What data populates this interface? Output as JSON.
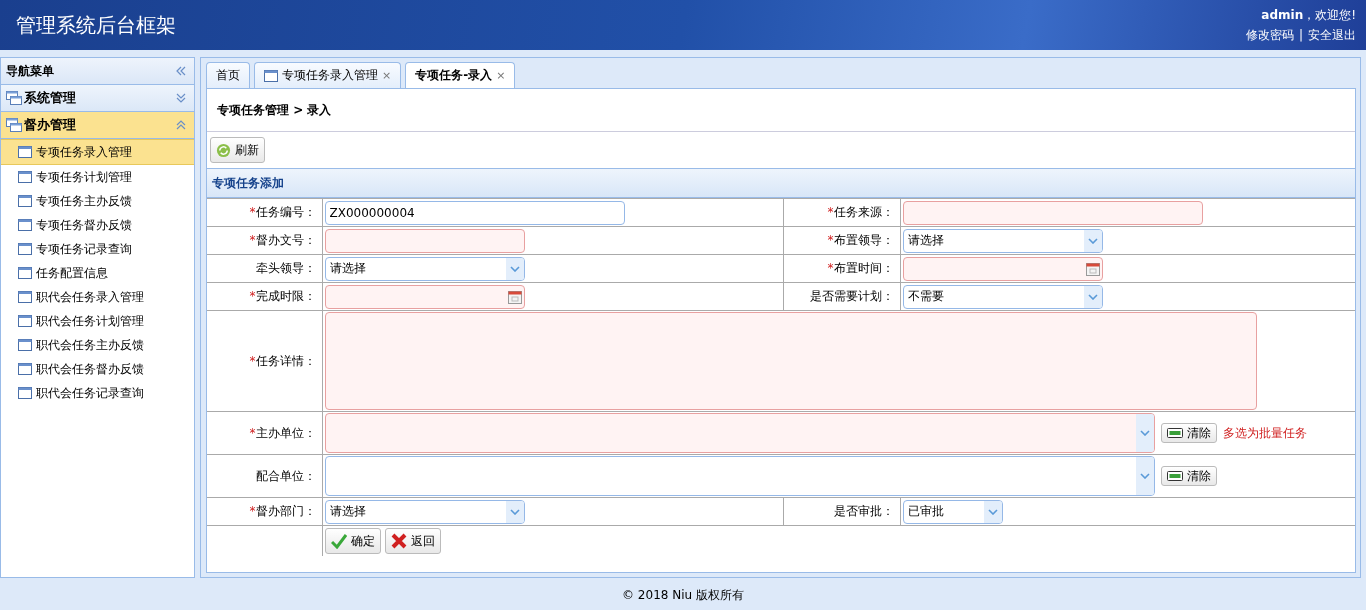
{
  "header": {
    "title": "管理系统后台框架",
    "user": "admin",
    "welcome": "，欢迎您!",
    "links": [
      "修改密码",
      "安全退出"
    ],
    "separator": "|"
  },
  "sidebar": {
    "title": "导航菜单",
    "groups": [
      {
        "label": "系统管理",
        "expanded": false,
        "selected": false
      },
      {
        "label": "督办管理",
        "expanded": true,
        "selected": true,
        "items": [
          {
            "label": "专项任务录入管理",
            "selected": true
          },
          {
            "label": "专项任务计划管理",
            "selected": false
          },
          {
            "label": "专项任务主办反馈",
            "selected": false
          },
          {
            "label": "专项任务督办反馈",
            "selected": false
          },
          {
            "label": "专项任务记录查询",
            "selected": false
          },
          {
            "label": "任务配置信息",
            "selected": false
          },
          {
            "label": "职代会任务录入管理",
            "selected": false
          },
          {
            "label": "职代会任务计划管理",
            "selected": false
          },
          {
            "label": "职代会任务主办反馈",
            "selected": false
          },
          {
            "label": "职代会任务督办反馈",
            "selected": false
          },
          {
            "label": "职代会任务记录查询",
            "selected": false
          }
        ]
      }
    ]
  },
  "tabs": [
    {
      "label": "首页",
      "selected": false,
      "icon": false
    },
    {
      "label": "专项任务录入管理",
      "selected": false,
      "icon": true,
      "close": "×"
    },
    {
      "label": "专项任务-录入",
      "selected": true,
      "icon": false,
      "close": "×"
    }
  ],
  "breadcrumb": "专项任务管理 > 录入",
  "toolbar": {
    "refresh": "刷新"
  },
  "form": {
    "title": "专项任务添加",
    "rows": [
      {
        "kind": "pair",
        "fields": [
          {
            "label": "任务编号：",
            "required": true,
            "kind": "text",
            "value": "ZX000000004",
            "invalid": false
          },
          {
            "label": "任务来源：",
            "required": true,
            "kind": "text",
            "invalid": true
          }
        ]
      },
      {
        "kind": "pair",
        "fields": [
          {
            "label": "督办文号：",
            "required": true,
            "kind": "text",
            "invalid": true
          },
          {
            "label": "布置领导：",
            "required": true,
            "kind": "select",
            "value": "请选择",
            "invalid": false
          }
        ]
      },
      {
        "kind": "pair",
        "fields": [
          {
            "label": "牵头领导：",
            "required": false,
            "kind": "select",
            "value": "请选择",
            "invalid": false
          },
          {
            "label": "布置时间：",
            "required": true,
            "kind": "date",
            "invalid": true
          }
        ]
      },
      {
        "kind": "pair",
        "fields": [
          {
            "label": "完成时限：",
            "required": true,
            "kind": "date",
            "invalid": true
          },
          {
            "label": "是否需要计划：",
            "required": false,
            "kind": "select",
            "value": "不需要",
            "invalid": false
          }
        ]
      },
      {
        "kind": "full",
        "fields": [
          {
            "label": "任务详情：",
            "required": true,
            "kind": "textarea",
            "invalid": true
          }
        ]
      },
      {
        "kind": "full",
        "fields": [
          {
            "label": "主办单位：",
            "required": true,
            "kind": "multi",
            "invalid": true,
            "clear": "清除",
            "hint": "多选为批量任务"
          }
        ]
      },
      {
        "kind": "full",
        "fields": [
          {
            "label": "配合单位：",
            "required": false,
            "kind": "multi",
            "invalid": false,
            "clear": "清除"
          }
        ]
      },
      {
        "kind": "pair",
        "fields": [
          {
            "label": "督办部门：",
            "required": true,
            "kind": "select",
            "value": "请选择",
            "invalid": false
          },
          {
            "label": "是否审批：",
            "required": false,
            "kind": "select",
            "value": "已审批",
            "invalid": false
          }
        ]
      }
    ],
    "required_mark": "*",
    "buttons": [
      {
        "label": "确定",
        "kind": "ok"
      },
      {
        "label": "返回",
        "kind": "back"
      }
    ]
  },
  "footer": "© 2018 Niu 版权所有"
}
